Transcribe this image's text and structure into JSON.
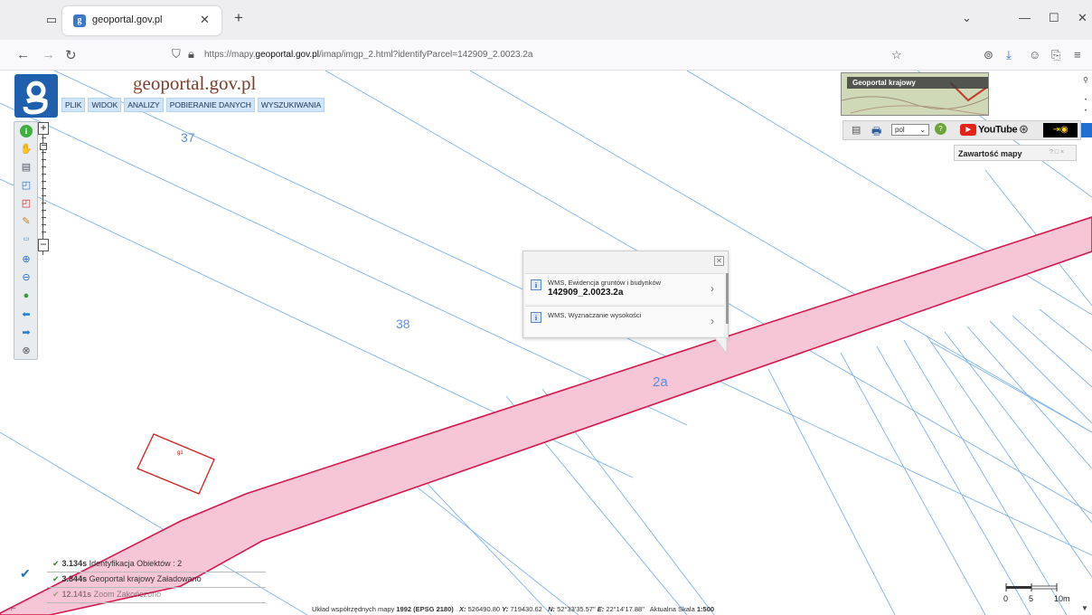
{
  "browser": {
    "tab_title": "geoportal.gov.pl",
    "url_prefix": "https://mapy.",
    "url_domain": "geoportal.gov.pl",
    "url_path": "/imap/imgp_2.html?identifyParcel=142909_2.0023.2a"
  },
  "site": {
    "title_g": "g",
    "title_rest": "eoportal.gov.pl"
  },
  "menu": [
    "PLIK",
    "WIDOK",
    "ANALIZY",
    "POBIERANIE DANYCH",
    "WYSZUKIWANIA"
  ],
  "parcels": {
    "p37": "37",
    "p38": "38",
    "p2a": "2a",
    "small_building": "g1"
  },
  "minimap": {
    "label": "Geoportal krajowy"
  },
  "topbar": {
    "language": "pol",
    "youtube": "YouTube"
  },
  "panel": {
    "title": "Zawartość mapy",
    "buttons": "? □ ×"
  },
  "popup": {
    "rows": [
      {
        "title": "WMS, Ewidencja gruntów i budynków",
        "subtitle": "142909_2.0023.2a"
      },
      {
        "title": "WMS, Wyznaczanie wysokości",
        "subtitle": ""
      }
    ]
  },
  "log": [
    {
      "time": "3.134s",
      "text": "Identyfikacja  Obiektów : 2"
    },
    {
      "time": "3.844s",
      "text": "Geoportal krajowy  Załadowano"
    },
    {
      "time": "12.141s",
      "text": "Zoom  Zakończono"
    }
  ],
  "footer": {
    "system_label": "Układ współrzędnych mapy",
    "system_value": "1992 (EPSG 2180)",
    "x_label": "X:",
    "x_value": "526490.80",
    "y_label": "Y:",
    "y_value": "719430.62",
    "n_label": "N:",
    "n_value": "52°33'35.57\"",
    "e_label": "E:",
    "e_value": "22°14'17.88\"",
    "scale_label": "Aktualna Skala",
    "scale_value": "1:500"
  },
  "scalebar": {
    "s0": "0",
    "s5": "5",
    "s10": "10m"
  },
  "colors": {
    "parcel_line": "#7fb3e8",
    "road_fill": "#f7c6d6",
    "road_stroke": "#d6194f",
    "building": "#d42020"
  }
}
